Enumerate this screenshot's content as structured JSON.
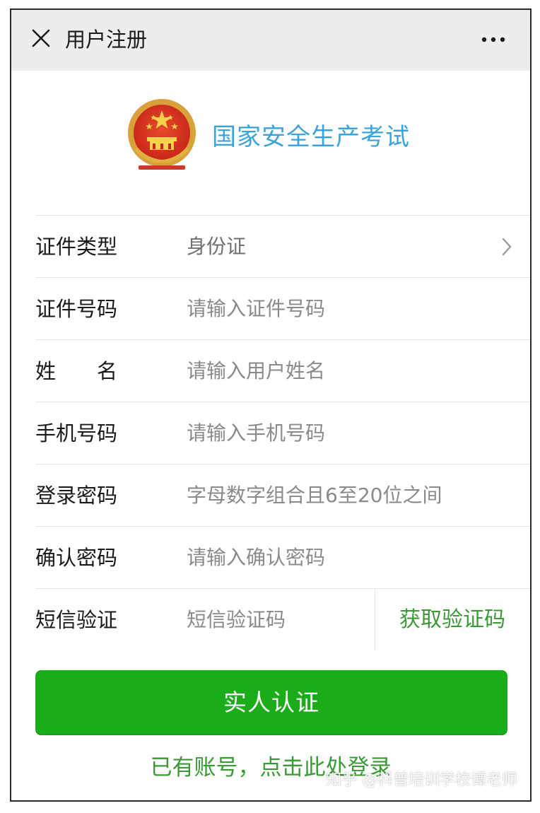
{
  "header": {
    "title": "用户注册",
    "close_icon": "close-icon",
    "more_icon": "more-icon"
  },
  "brand": {
    "emblem": "national-emblem",
    "name": "国家安全生产考试",
    "color": "#3aa3d9"
  },
  "form": {
    "id_type": {
      "label": "证件类型",
      "value": "身份证"
    },
    "id_number": {
      "label": "证件号码",
      "placeholder": "请输入证件号码"
    },
    "name": {
      "label": "姓　　名",
      "placeholder": "请输入用户姓名"
    },
    "phone": {
      "label": "手机号码",
      "placeholder": "请输入手机号码"
    },
    "password": {
      "label": "登录密码",
      "placeholder": "字母数字组合且6至20位之间"
    },
    "confirm_password": {
      "label": "确认密码",
      "placeholder": "请输入确认密码"
    },
    "sms": {
      "label": "短信验证",
      "placeholder": "短信验证码",
      "button_label": "获取验证码"
    }
  },
  "actions": {
    "verify_label": "实人认证",
    "login_link": "已有账号，点击此处登录",
    "primary_color": "#1aad19",
    "link_color": "#3a9a35"
  },
  "watermark": "知乎 @科普培训学校谭老师"
}
